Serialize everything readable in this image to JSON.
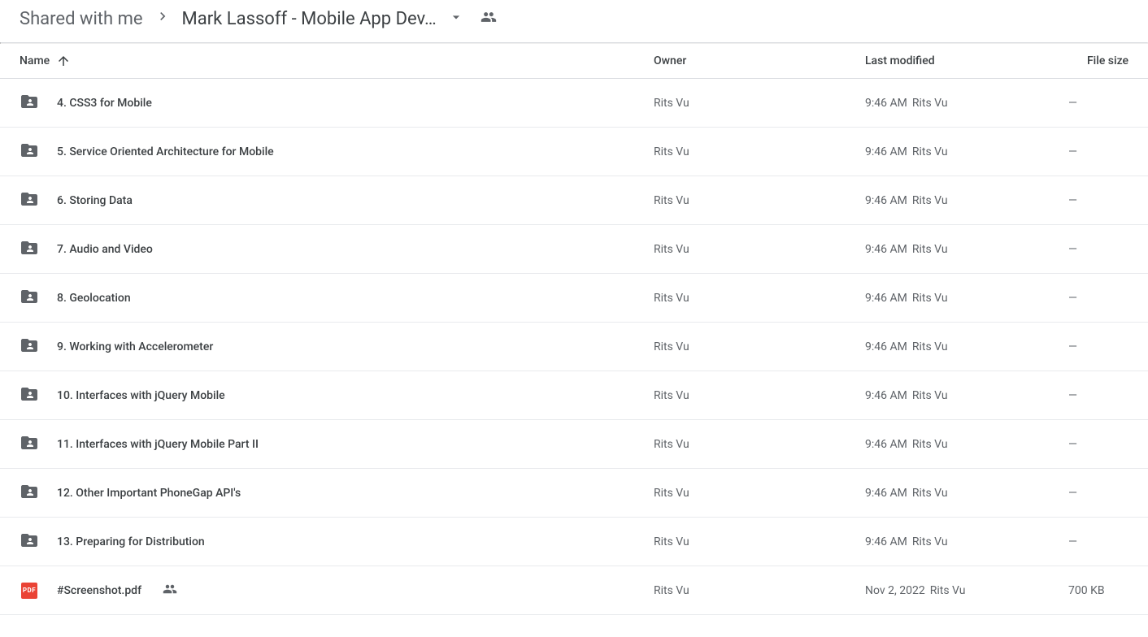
{
  "breadcrumb": {
    "root": "Shared with me",
    "current": "Mark Lassoff - Mobile App Dev…"
  },
  "columns": {
    "name": "Name",
    "owner": "Owner",
    "modified": "Last modified",
    "size": "File size"
  },
  "rows": [
    {
      "type": "folder",
      "name": "4. CSS3 for Mobile",
      "owner": "Rits Vu",
      "modified_time": "9:46 AM",
      "modified_by": "Rits Vu",
      "size": "—",
      "shared": false
    },
    {
      "type": "folder",
      "name": "5. Service Oriented Architecture for Mobile",
      "owner": "Rits Vu",
      "modified_time": "9:46 AM",
      "modified_by": "Rits Vu",
      "size": "—",
      "shared": false
    },
    {
      "type": "folder",
      "name": "6. Storing Data",
      "owner": "Rits Vu",
      "modified_time": "9:46 AM",
      "modified_by": "Rits Vu",
      "size": "—",
      "shared": false
    },
    {
      "type": "folder",
      "name": "7. Audio and Video",
      "owner": "Rits Vu",
      "modified_time": "9:46 AM",
      "modified_by": "Rits Vu",
      "size": "—",
      "shared": false
    },
    {
      "type": "folder",
      "name": "8. Geolocation",
      "owner": "Rits Vu",
      "modified_time": "9:46 AM",
      "modified_by": "Rits Vu",
      "size": "—",
      "shared": false
    },
    {
      "type": "folder",
      "name": "9. Working with Accelerometer",
      "owner": "Rits Vu",
      "modified_time": "9:46 AM",
      "modified_by": "Rits Vu",
      "size": "—",
      "shared": false
    },
    {
      "type": "folder",
      "name": "10. Interfaces with jQuery Mobile",
      "owner": "Rits Vu",
      "modified_time": "9:46 AM",
      "modified_by": "Rits Vu",
      "size": "—",
      "shared": false
    },
    {
      "type": "folder",
      "name": "11. Interfaces with jQuery Mobile Part II",
      "owner": "Rits Vu",
      "modified_time": "9:46 AM",
      "modified_by": "Rits Vu",
      "size": "—",
      "shared": false
    },
    {
      "type": "folder",
      "name": "12. Other Important PhoneGap API's",
      "owner": "Rits Vu",
      "modified_time": "9:46 AM",
      "modified_by": "Rits Vu",
      "size": "—",
      "shared": false
    },
    {
      "type": "folder",
      "name": "13. Preparing for Distribution",
      "owner": "Rits Vu",
      "modified_time": "9:46 AM",
      "modified_by": "Rits Vu",
      "size": "—",
      "shared": false
    },
    {
      "type": "pdf",
      "name": "#Screenshot.pdf",
      "owner": "Rits Vu",
      "modified_time": "Nov 2, 2022",
      "modified_by": "Rits Vu",
      "size": "700 KB",
      "shared": true
    }
  ]
}
